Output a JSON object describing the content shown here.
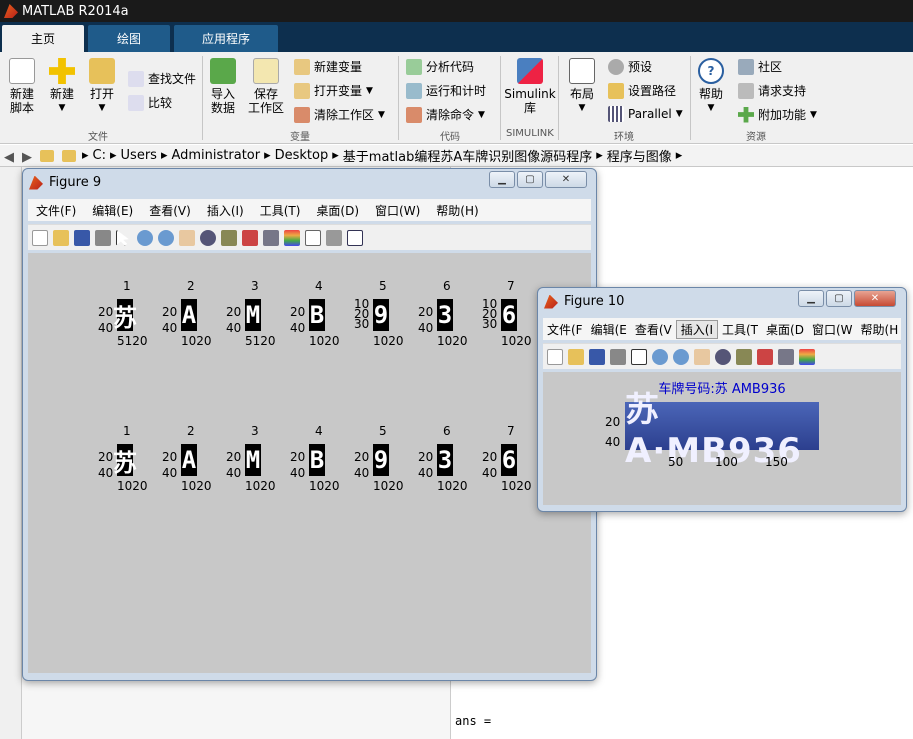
{
  "app_title": "MATLAB R2014a",
  "tabs": [
    "主页",
    "绘图",
    "应用程序"
  ],
  "ribbon": {
    "new_script": "新建\n脚本",
    "new": "新建",
    "open": "打开",
    "find_files": "查找文件",
    "compare": "比较",
    "import_data": "导入\n数据",
    "save_workspace": "保存\n工作区",
    "new_variable": "新建变量",
    "open_variable": "打开变量",
    "clear_workspace": "清除工作区",
    "analyze_code": "分析代码",
    "run_and_time": "运行和计时",
    "clear_commands": "清除命令",
    "simulink": "Simulink\n库",
    "layout": "布局",
    "preferences": "预设",
    "set_path": "设置路径",
    "parallel": "Parallel",
    "help": "帮助",
    "community": "社区",
    "request_support": "请求支持",
    "addons": "附加功能",
    "groups": [
      "文件",
      "变量",
      "代码",
      "SIMULINK",
      "环境",
      "资源"
    ]
  },
  "path": [
    "C:",
    "Users",
    "Administrator",
    "Desktop",
    "基于matlab编程苏A车牌识别图像源码程序",
    "程序与图像"
  ],
  "figure9": {
    "title": "Figure 9",
    "menu": [
      "文件(F)",
      "编辑(E)",
      "查看(V)",
      "插入(I)",
      "工具(T)",
      "桌面(D)",
      "窗口(W)",
      "帮助(H)"
    ],
    "row1": [
      {
        "num": "1",
        "glyph": "苏",
        "yt": [
          "20",
          "40"
        ],
        "xt": "5120"
      },
      {
        "num": "2",
        "glyph": "A",
        "yt": [
          "20",
          "40"
        ],
        "xt": "1020"
      },
      {
        "num": "3",
        "glyph": "M",
        "yt": [
          "20",
          "40"
        ],
        "xt": "5120"
      },
      {
        "num": "4",
        "glyph": "B",
        "yt": [
          "20",
          "40"
        ],
        "xt": "1020"
      },
      {
        "num": "5",
        "glyph": "9",
        "yt": [
          "10",
          "20",
          "30"
        ],
        "xt": "1020"
      },
      {
        "num": "6",
        "glyph": "3",
        "yt": [
          "20",
          "40"
        ],
        "xt": "1020"
      },
      {
        "num": "7",
        "glyph": "6",
        "yt": [
          "10",
          "20",
          "30"
        ],
        "xt": "1020"
      }
    ],
    "row2": [
      {
        "num": "1",
        "glyph": "苏",
        "yt": [
          "20",
          "40"
        ],
        "xt": "1020"
      },
      {
        "num": "2",
        "glyph": "A",
        "yt": [
          "20",
          "40"
        ],
        "xt": "1020"
      },
      {
        "num": "3",
        "glyph": "M",
        "yt": [
          "20",
          "40"
        ],
        "xt": "1020"
      },
      {
        "num": "4",
        "glyph": "B",
        "yt": [
          "20",
          "40"
        ],
        "xt": "1020"
      },
      {
        "num": "5",
        "glyph": "9",
        "yt": [
          "20",
          "40"
        ],
        "xt": "1020"
      },
      {
        "num": "6",
        "glyph": "3",
        "yt": [
          "20",
          "40"
        ],
        "xt": "1020"
      },
      {
        "num": "7",
        "glyph": "6",
        "yt": [
          "20",
          "40"
        ],
        "xt": "1020"
      }
    ]
  },
  "figure10": {
    "title": "Figure 10",
    "menu": [
      "文件(F",
      "编辑(E",
      "查看(V",
      "插入(I",
      "工具(T",
      "桌面(D",
      "窗口(W",
      "帮助(H"
    ],
    "plate_title": "车牌号码:苏 AMB936",
    "plate_text": "苏A·MB936",
    "yticks": [
      "20",
      "40"
    ],
    "xticks": [
      "50",
      "100",
      "150"
    ]
  },
  "cmd": {
    "ans": "ans ="
  },
  "colors": {
    "accent": "#0d2f4e",
    "title_blue": "#0000cc"
  }
}
